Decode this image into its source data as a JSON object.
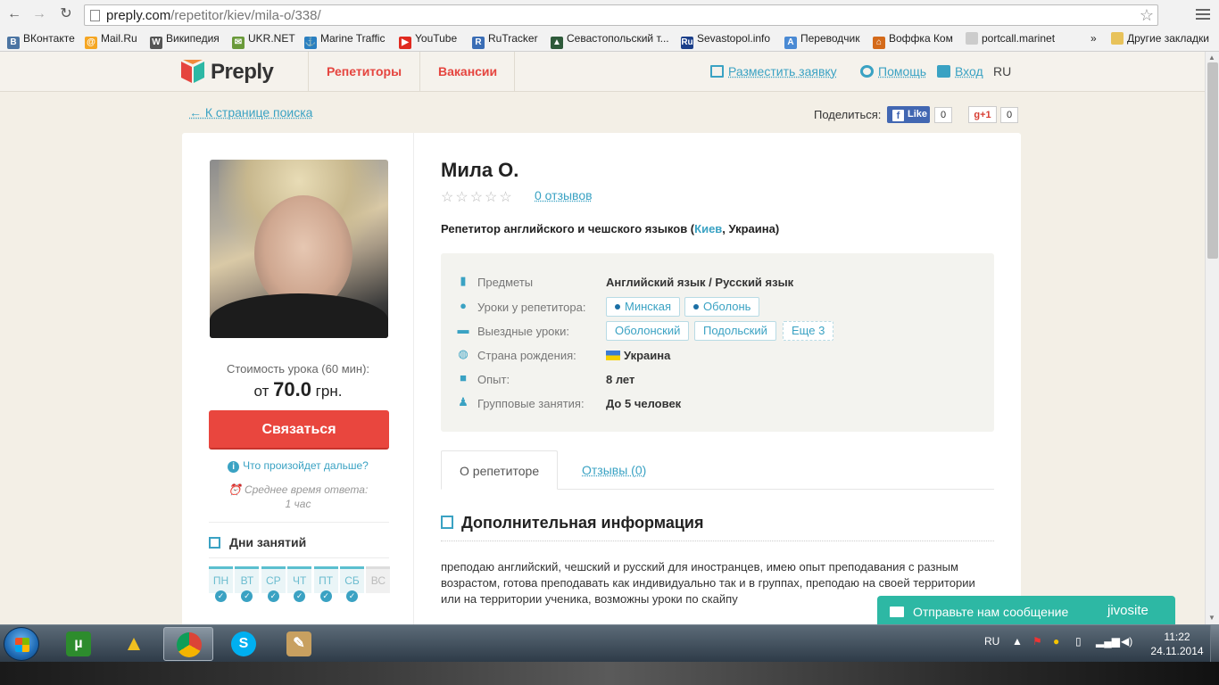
{
  "browser": {
    "url_host": "preply.com",
    "url_path": "/repetitor/kiev/mila-o/338/",
    "bookmarks": [
      {
        "label": "ВКонтакте",
        "icon": "vk-icon",
        "color": "#4c75a3",
        "glyph": "B"
      },
      {
        "label": "Mail.Ru",
        "icon": "mailru-icon",
        "color": "#f5a623",
        "glyph": "@"
      },
      {
        "label": "Википедия",
        "icon": "wikipedia-icon",
        "color": "#555555",
        "glyph": "W"
      },
      {
        "label": "UKR.NET",
        "icon": "ukrnet-icon",
        "color": "#6a9a3a",
        "glyph": "✉"
      },
      {
        "label": "Marine Traffic",
        "icon": "marine-traffic-icon",
        "color": "#2a7fc1",
        "glyph": "⚓"
      },
      {
        "label": "YouTube",
        "icon": "youtube-icon",
        "color": "#e02a20",
        "glyph": "▶"
      },
      {
        "label": "RuTracker",
        "icon": "rutracker-icon",
        "color": "#3a6db5",
        "glyph": "R"
      },
      {
        "label": "Севастопольский т...",
        "icon": "sevastopol-icon",
        "color": "#2e5a3a",
        "glyph": "▲"
      },
      {
        "label": "Sevastopol.info",
        "icon": "sevastopol-info-icon",
        "color": "#1b3f8a",
        "glyph": "Ru"
      },
      {
        "label": "Переводчик",
        "icon": "translator-icon",
        "color": "#4a8ad4",
        "glyph": "A"
      },
      {
        "label": "Воффка Ком",
        "icon": "home-icon",
        "color": "#d46a1a",
        "glyph": "⌂"
      },
      {
        "label": "portcall.marinet",
        "icon": "page-icon",
        "color": "#cccccc",
        "glyph": ""
      }
    ],
    "overflow_label": "»",
    "other_bookmarks": "Другие закладки"
  },
  "site": {
    "logo": "Preply",
    "nav": [
      "Репетиторы",
      "Вакансии"
    ],
    "post_request": "Разместить заявку",
    "help": "Помощь",
    "login": "Вход",
    "lang": "RU",
    "back": "← К странице поиска",
    "share_label": "Поделиться:",
    "fb_like": "Like",
    "fb_count": "0",
    "gplus": "g+1",
    "gplus_count": "0"
  },
  "tutor": {
    "name": "Мила О.",
    "rating": 0,
    "stars": "☆☆☆☆☆",
    "reviews": "0 отзывов",
    "title": "Репетитор английского и чешского языков (",
    "city": "Киев",
    "country_suffix": ", Украина)",
    "price_label": "Стоимость урока (60 мин):",
    "price_prefix": "от ",
    "price_value": "70.0",
    "price_suffix": " грн.",
    "contact_button": "Связаться",
    "what_next": "Что произойдет дальше?",
    "response_label": "Среднее время ответа:",
    "response_value": "1 час",
    "days_title": "Дни занятий",
    "days": [
      {
        "label": "ПН",
        "active": true
      },
      {
        "label": "ВТ",
        "active": true
      },
      {
        "label": "СР",
        "active": true
      },
      {
        "label": "ЧТ",
        "active": true
      },
      {
        "label": "ПТ",
        "active": true
      },
      {
        "label": "СБ",
        "active": true
      },
      {
        "label": "ВС",
        "active": false
      }
    ],
    "info": {
      "subjects_label": "Предметы",
      "subjects_value": "Английский язык / Русский язык",
      "at_tutor_label": "Уроки у репетитора:",
      "at_tutor_tags": [
        "Минская",
        "Оболонь"
      ],
      "visit_label": "Выездные уроки:",
      "visit_tags": [
        "Оболонский",
        "Подольский"
      ],
      "visit_more": "Еще 3",
      "birth_label": "Страна рождения:",
      "birth_value": "Украина",
      "exp_label": "Опыт:",
      "exp_value": "8 лет",
      "group_label": "Групповые занятия:",
      "group_value": "До 5 человек"
    },
    "tab_about": "О репетиторе",
    "tab_reviews": "Отзывы (0)",
    "additional_title": "Дополнительная информация",
    "description": "преподаю английский, чешский и русский для иностранцев, имею опыт преподавания с разным возрастом, готова преподавать как индивидуально так и в группах, преподаю на своей территории или на территории ученика, возможны уроки по скайпу"
  },
  "chat": {
    "label": "Отправьте нам сообщение",
    "brand": "jivosite"
  },
  "taskbar": {
    "lang": "RU",
    "time": "11:22",
    "date": "24.11.2014"
  }
}
